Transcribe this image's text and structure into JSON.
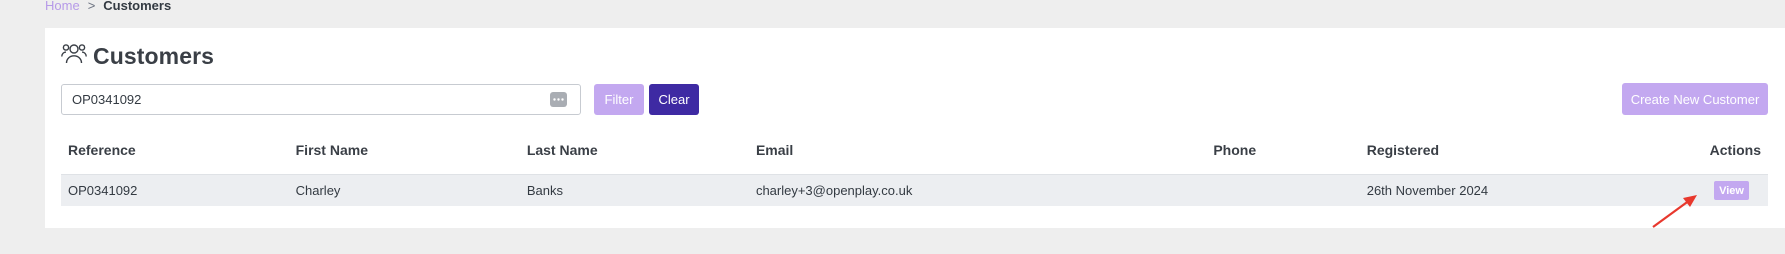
{
  "breadcrumb": {
    "home": "Home",
    "separator": ">",
    "current": "Customers"
  },
  "page": {
    "title": "Customers",
    "title_icon": "users-icon"
  },
  "search": {
    "value": "OP0341092",
    "placeholder": "",
    "icon": "dots-icon"
  },
  "buttons": {
    "filter": "Filter",
    "clear": "Clear",
    "create": "Create New Customer"
  },
  "table": {
    "headers": {
      "reference": "Reference",
      "first_name": "First Name",
      "last_name": "Last Name",
      "email": "Email",
      "phone": "Phone",
      "registered": "Registered",
      "actions": "Actions"
    },
    "rows": [
      {
        "reference": "OP0341092",
        "first_name": "Charley",
        "last_name": "Banks",
        "email": "charley+3@openplay.co.uk",
        "phone": "",
        "registered": "26th November 2024",
        "action_label": "View"
      }
    ]
  },
  "colors": {
    "accent_light": "#c3a8f0",
    "accent_dark": "#3e2aa3",
    "annotation_arrow": "#e8382d"
  }
}
